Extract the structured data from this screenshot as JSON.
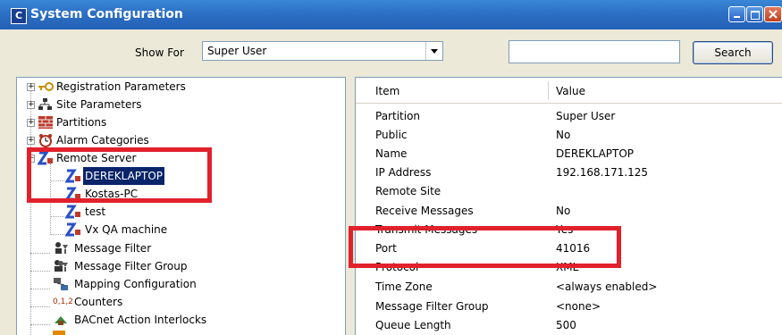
{
  "window": {
    "title": "System Configuration",
    "app_icon": "C"
  },
  "toolbar": {
    "show_for_label": "Show For",
    "show_for_value": "Super User",
    "search_placeholder": "",
    "search_button": "Search"
  },
  "tree": {
    "items": [
      {
        "label": "Registration Parameters",
        "icon": "key-icon"
      },
      {
        "label": "Site Parameters",
        "icon": "site-network-icon"
      },
      {
        "label": "Partitions",
        "icon": "brick-wall-icon"
      },
      {
        "label": "Alarm Categories",
        "icon": "alarm-clock-icon"
      },
      {
        "label": "Remote Server",
        "icon": "remote-server-icon"
      },
      {
        "label": "DEREKLAPTOP",
        "icon": "remote-server-icon"
      },
      {
        "label": "Kostas-PC",
        "icon": "remote-server-icon"
      },
      {
        "label": "test",
        "icon": "remote-server-icon"
      },
      {
        "label": "Vx QA machine",
        "icon": "remote-server-icon"
      },
      {
        "label": "Message Filter",
        "icon": "message-filter-icon"
      },
      {
        "label": "Message Filter Group",
        "icon": "message-filter-group-icon"
      },
      {
        "label": "Mapping Configuration",
        "icon": "mapping-icon"
      },
      {
        "label": "Counters",
        "icon": "counters-icon"
      },
      {
        "label": "BACnet Action Interlocks",
        "icon": "bacnet-icon"
      }
    ],
    "counters_glyph": "0,1,2"
  },
  "grid": {
    "headers": {
      "item": "Item",
      "value": "Value"
    },
    "rows": [
      {
        "item": "Partition",
        "value": "Super User"
      },
      {
        "item": "Public",
        "value": "No"
      },
      {
        "item": "Name",
        "value": "DEREKLAPTOP"
      },
      {
        "item": "IP Address",
        "value": "192.168.171.125"
      },
      {
        "item": "Remote Site",
        "value": ""
      },
      {
        "item": "Receive Messages",
        "value": "No"
      },
      {
        "item": "Transmit Messages",
        "value": "Yes"
      },
      {
        "item": "Port",
        "value": "41016"
      },
      {
        "item": "Protocol",
        "value": "XML"
      },
      {
        "item": "Time Zone",
        "value": "<always enabled>"
      },
      {
        "item": "Message Filter Group",
        "value": "<none>"
      },
      {
        "item": "Queue Length",
        "value": "500"
      }
    ]
  },
  "colors": {
    "highlight": "#e1212b",
    "selection": "#0a246a",
    "titlebar": "#2c6fc4"
  }
}
